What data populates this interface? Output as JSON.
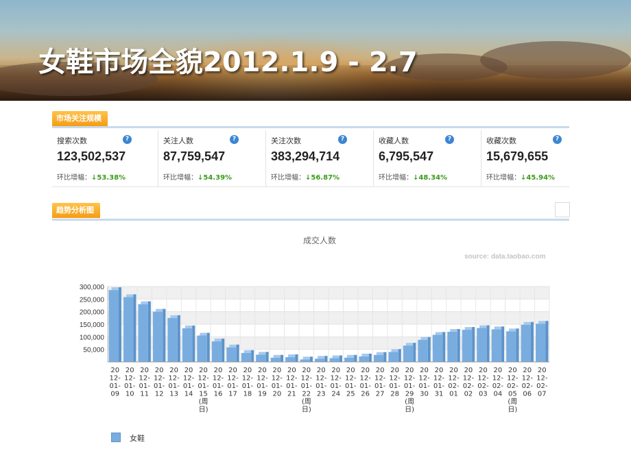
{
  "banner": {
    "title": "女鞋市场全貌2012.1.9 - 2.7"
  },
  "sections": {
    "attention_scale": "市场关注规模",
    "trend_analysis": "趋势分析图"
  },
  "stats": [
    {
      "label": "搜索次数",
      "value": "123,502,537",
      "change_label": "环比增幅：",
      "change_value": "53.38%"
    },
    {
      "label": "关注人数",
      "value": "87,759,547",
      "change_label": "环比增幅：",
      "change_value": "54.39%"
    },
    {
      "label": "关注次数",
      "value": "383,294,714",
      "change_label": "环比增幅：",
      "change_value": "56.87%"
    },
    {
      "label": "收藏人数",
      "value": "6,795,547",
      "change_label": "环比增幅：",
      "change_value": "48.34%"
    },
    {
      "label": "收藏次数",
      "value": "15,679,655",
      "change_label": "环比增幅：",
      "change_value": "45.94%"
    }
  ],
  "help_icon_glyph": "?",
  "change_arrow": "↓",
  "chart_data": {
    "type": "bar",
    "title": "成交人数",
    "source": "source: data.taobao.com",
    "xlabel": "",
    "ylabel": "",
    "ylim": [
      0,
      300000
    ],
    "yticks": [
      "50,000",
      "100,000",
      "150,000",
      "200,000",
      "250,000",
      "300,000"
    ],
    "grid": true,
    "legend_position": "bottom-left",
    "colors": {
      "bar": "#79ade0",
      "bar_dark": "#5d93c9",
      "grid_band": "#f0f0f0"
    },
    "categories": [
      [
        "20",
        "12-",
        "01-",
        "09"
      ],
      [
        "20",
        "12-",
        "01-",
        "10"
      ],
      [
        "20",
        "12-",
        "01-",
        "11"
      ],
      [
        "20",
        "12-",
        "01-",
        "12"
      ],
      [
        "20",
        "12-",
        "01-",
        "13"
      ],
      [
        "20",
        "12-",
        "01-",
        "14"
      ],
      [
        "20",
        "12-",
        "01-",
        "15",
        "(周",
        "日)"
      ],
      [
        "20",
        "12-",
        "01-",
        "16"
      ],
      [
        "20",
        "12-",
        "01-",
        "17"
      ],
      [
        "20",
        "12-",
        "01-",
        "18"
      ],
      [
        "20",
        "12-",
        "01-",
        "19"
      ],
      [
        "20",
        "12-",
        "01-",
        "20"
      ],
      [
        "20",
        "12-",
        "01-",
        "21"
      ],
      [
        "20",
        "12-",
        "01-",
        "22",
        "(周",
        "日)"
      ],
      [
        "20",
        "12-",
        "01-",
        "23"
      ],
      [
        "20",
        "12-",
        "01-",
        "24"
      ],
      [
        "20",
        "12-",
        "01-",
        "25"
      ],
      [
        "20",
        "12-",
        "01-",
        "26"
      ],
      [
        "20",
        "12-",
        "01-",
        "27"
      ],
      [
        "20",
        "12-",
        "01-",
        "28"
      ],
      [
        "20",
        "12-",
        "01-",
        "29",
        "(周",
        "日)"
      ],
      [
        "20",
        "12-",
        "01-",
        "30"
      ],
      [
        "20",
        "12-",
        "01-",
        "31"
      ],
      [
        "20",
        "12-",
        "02-",
        "01"
      ],
      [
        "20",
        "12-",
        "02-",
        "02"
      ],
      [
        "20",
        "12-",
        "02-",
        "03"
      ],
      [
        "20",
        "12-",
        "02-",
        "04"
      ],
      [
        "20",
        "12-",
        "02-",
        "05",
        "(周",
        "日)"
      ],
      [
        "20",
        "12-",
        "02-",
        "06"
      ],
      [
        "20",
        "12-",
        "02-",
        "07"
      ]
    ],
    "series": [
      {
        "name": "女鞋",
        "values": [
          286000,
          258000,
          230000,
          200000,
          175000,
          134000,
          105000,
          82000,
          58000,
          36000,
          29000,
          17000,
          19000,
          10000,
          13000,
          15000,
          17000,
          22000,
          28000,
          40000,
          65000,
          88000,
          108000,
          120000,
          128000,
          135000,
          130000,
          122000,
          148000,
          152000
        ]
      }
    ]
  }
}
